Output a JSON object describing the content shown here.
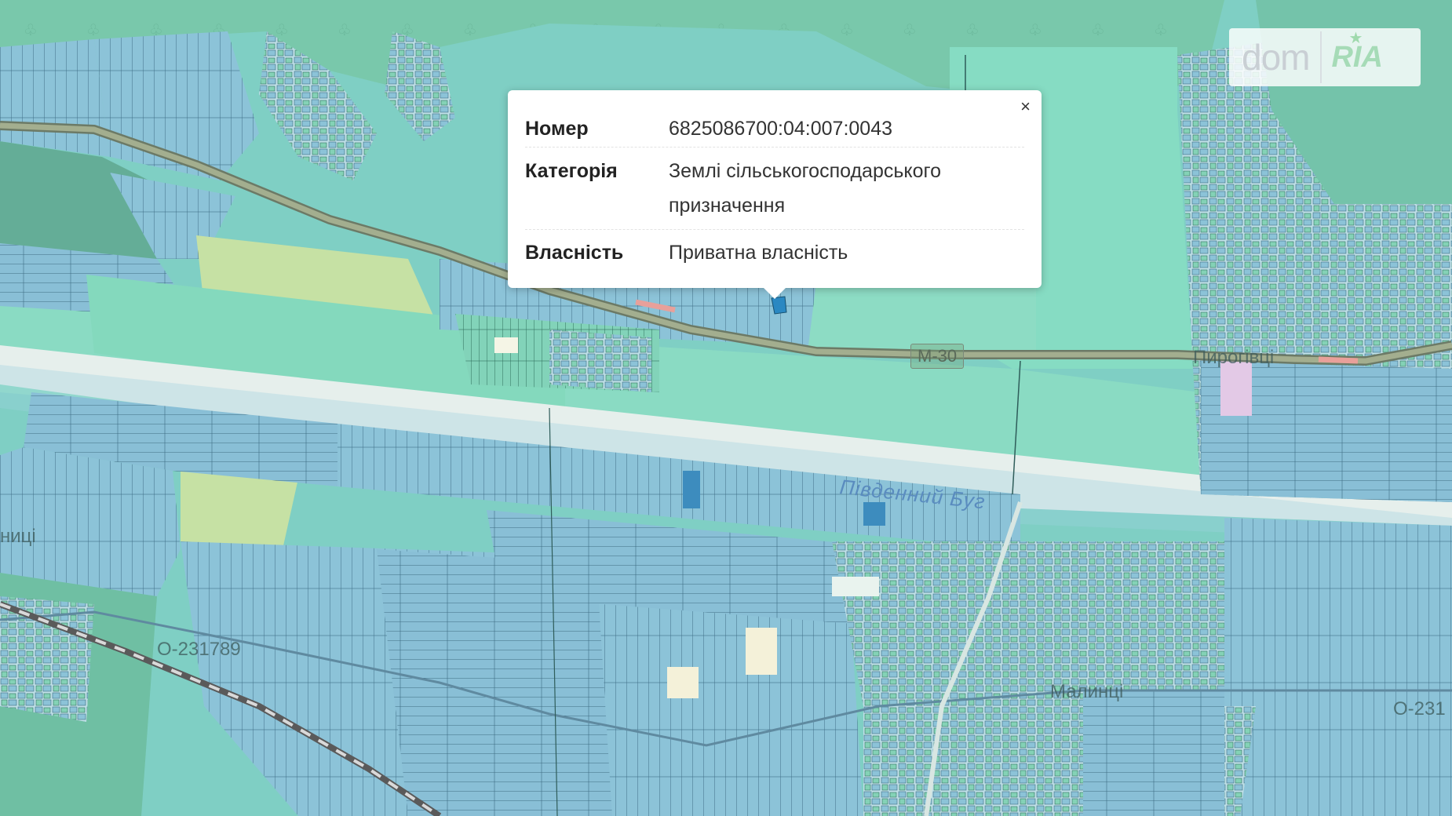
{
  "popup": {
    "rows": [
      {
        "key": "Номер",
        "value": "6825086700:04:007:0043"
      },
      {
        "key": "Категорія",
        "value": "Землі сільськогосподарського призначення"
      },
      {
        "key": "Власність",
        "value": "Приватна власність"
      }
    ],
    "close_label": "×"
  },
  "map_labels": {
    "river": "Південний Буг",
    "road_m30": "М-30",
    "road_o23": "О-231789",
    "road_o23b": "О-231",
    "village_east": "Пирогівці",
    "village_south": "Малинці",
    "village_west": "ниці"
  },
  "logo": {
    "dom_text": "dom",
    "ria_text": "RIA",
    "star": "★"
  },
  "colors": {
    "parcel_blue": "#8cc3d8",
    "parcel_green": "#7fd1b6",
    "field_green": "#8ddcc0",
    "forest": "#7cc9ab",
    "river_sand": "#e9f1ee",
    "road": "#9a9e88",
    "park": "#c6e1a4"
  }
}
